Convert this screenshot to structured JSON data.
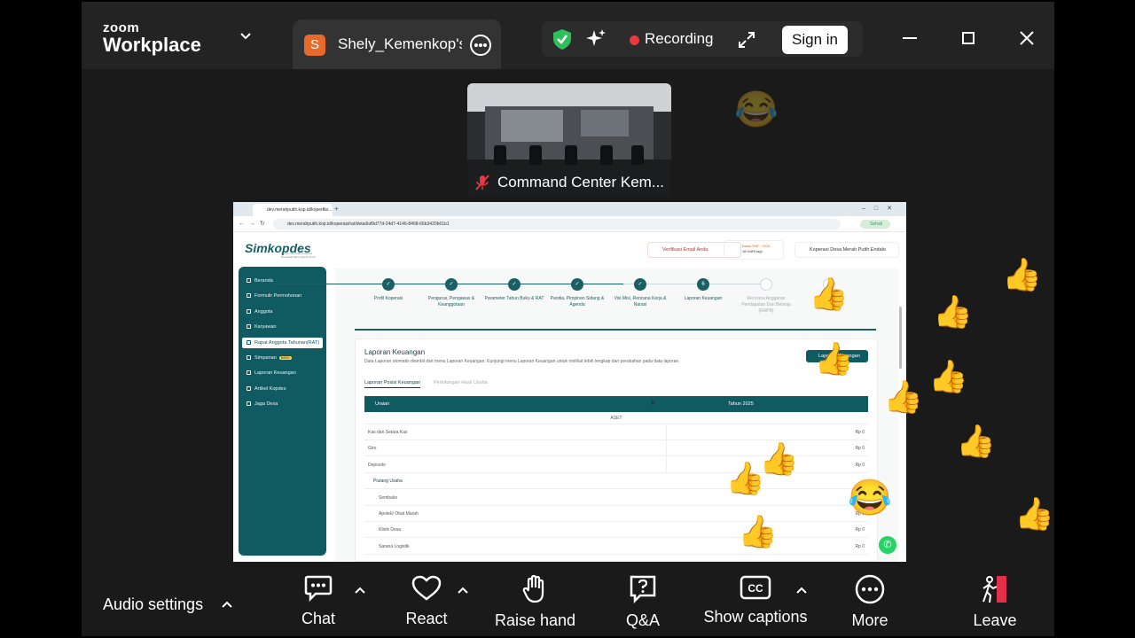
{
  "app": {
    "brand_small": "zoom",
    "brand_large": "Workplace"
  },
  "tab": {
    "avatar_letter": "S",
    "title": "Shely_Kemenkop's"
  },
  "status_bar": {
    "recording_label": "Recording",
    "signin_label": "Sign in",
    "recording_color": "#e7393e"
  },
  "video_tile": {
    "participant_name": "Command Center Kem..."
  },
  "shared_screen": {
    "browser": {
      "tab_title": "dev.merahputih.kop.id/koperasi...",
      "url": "dev.merahputih.kop.id/koperasi/rat/detail/af9d77d-24d7-4146-8468-66b3420b61b1",
      "profile_label": "Sehati"
    },
    "app_name": "Simkopdes",
    "app_tagline": "Sistem Informasi Koperasi Desa/Kelurahan Merah Putih",
    "header": {
      "verify_email": "Verifikasi Email Anda",
      "deadline_label": "Batas RAT · 2025",
      "deadline_value": "18 HARI lagi",
      "koperasi_name": "Koperasi Desa Merah Putih Endalo"
    },
    "sidebar": [
      {
        "label": "Beranda",
        "active": false
      },
      {
        "label": "Formulir Permohonan",
        "active": false
      },
      {
        "label": "Anggota",
        "active": false
      },
      {
        "label": "Karyawan",
        "active": false
      },
      {
        "label": "Rapat Anggota Tahunan(RAT)",
        "active": true
      },
      {
        "label": "Simpanan",
        "active": false,
        "badge": "BARU"
      },
      {
        "label": "Laporan Keuangan",
        "active": false
      },
      {
        "label": "Artikel Kopdes",
        "active": false
      },
      {
        "label": "Jaga Desa",
        "active": false
      }
    ],
    "steps": [
      {
        "label": "Profil Koperasi",
        "done": true
      },
      {
        "label": "Pengurus, Pengawas & Keanggotaan",
        "done": true
      },
      {
        "label": "Parameter Tahun Buku & RAT",
        "done": true
      },
      {
        "label": "Panitia, Pimpinan Sidang & Agenda",
        "done": true
      },
      {
        "label": "Visi Misi, Rencana Kerja & Narasi",
        "done": true
      },
      {
        "label": "Laporan Keuangan",
        "done": true,
        "number": "6"
      },
      {
        "label": "Rencana Anggaran Pendapatan Dan Belanja (RAPB)",
        "done": false
      },
      {
        "label": "",
        "done": false
      }
    ],
    "card": {
      "title": "Laporan Keuangan",
      "description": "Data Laporan otomatis diambil dari menu Laporan Keuangan. Kunjungi menu Laporan Keuangan untuk melihat lebih lengkap dan perubahan pada data laporan.",
      "button": "Laporan Keuangan",
      "subtabs": [
        "Laporan Posisi Keuangan",
        "Perhitungan Hasil Usaha"
      ],
      "columns": [
        "Uraian",
        "Tahun 2025"
      ],
      "section": "ASET",
      "rows": [
        {
          "label": "Kas dan Setara Kas",
          "value": "Rp 0",
          "indent": 0
        },
        {
          "label": "Giro",
          "value": "Rp 0",
          "indent": 0
        },
        {
          "label": "Deposito",
          "value": "Rp 0",
          "indent": 0
        },
        {
          "label": "Piutang Usaha",
          "value": "",
          "indent": 1
        },
        {
          "label": "Sembako",
          "value": "Rp 0",
          "indent": 2
        },
        {
          "label": "Apotek/ Obat Murah",
          "value": "Rp 0",
          "indent": 2
        },
        {
          "label": "Klinik Desa",
          "value": "Rp 0",
          "indent": 2
        },
        {
          "label": "Sarana Logistik",
          "value": "Rp 0",
          "indent": 2
        }
      ]
    }
  },
  "toolbar": {
    "audio_settings": "Audio settings",
    "chat": "Chat",
    "react": "React",
    "raise_hand": "Raise hand",
    "qa": "Q&A",
    "show_captions": "Show captions",
    "more": "More",
    "leave": "Leave",
    "captions_glyph": "CC",
    "leave_color": "#e0304a"
  },
  "reactions": {
    "thumbs_up": "👍",
    "laugh": "😂"
  }
}
